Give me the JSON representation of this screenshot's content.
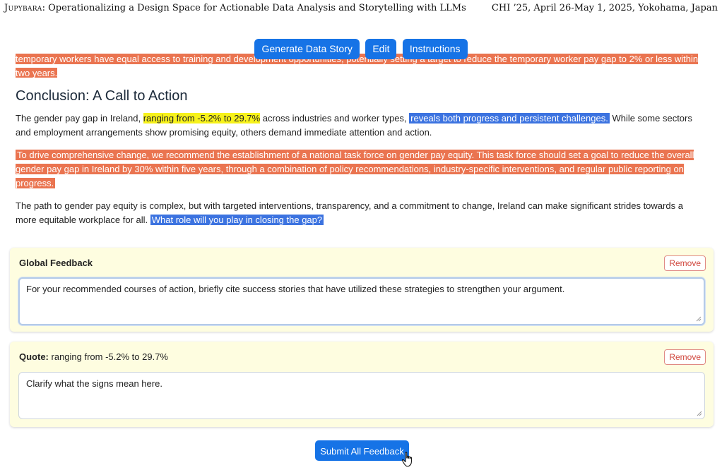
{
  "paper_header": {
    "brand": "Jupybara",
    "left_title": ": Operationalizing a Design Space for Actionable Data Analysis and Storytelling with LLMs",
    "right_text": "CHI ’25, April 26-May 1, 2025, Yokohama, Japan"
  },
  "toolbar": {
    "generate_label": "Generate Data Story",
    "edit_label": "Edit",
    "instructions_label": "Instructions"
  },
  "story": {
    "clipped_paragraph": "temporary workers have equal access to training and development opportunities, potentially setting a target to reduce the temporary worker pay gap to 2% or less within two years.",
    "heading": "Conclusion: A Call to Action",
    "p1_before": "The gender pay gap in Ireland, ",
    "p1_highlight_yellow": "ranging from -5.2% to 29.7%",
    "p1_middle": " across industries and worker types, ",
    "p1_highlight_blue": "reveals both progress and persistent challenges.",
    "p1_after": " While some sectors and employment arrangements show promising equity, others demand immediate attention and action.",
    "p2_highlight_orange": "To drive comprehensive change, we recommend the establishment of a national task force on gender pay equity. This task force should set a goal to reduce the overall gender pay gap in Ireland by 30% within five years, through a combination of policy recommendations, industry-specific interventions, and regular public reporting on progress.",
    "p3_text": "The path to gender pay equity is complex, but with targeted interventions, transparency, and a commitment to change, Ireland can make significant strides towards a more equitable workplace for all. ",
    "p3_highlight_blue": "What role will you play in closing the gap?"
  },
  "feedback": {
    "global": {
      "title": "Global Feedback",
      "remove_label": "Remove",
      "text": "For your recommended courses of action, briefly cite success stories that have utilized these strategies to strengthen your argument."
    },
    "quote": {
      "title_label": "Quote:",
      "quote_text": "ranging from -5.2% to 29.7%",
      "remove_label": "Remove",
      "text": "Clarify what the signs mean here."
    }
  },
  "submit_label": "Submit All Feedback",
  "colors": {
    "primary": "#1673e6",
    "highlight_orange": "#ea7450",
    "highlight_blue": "#3c73e0",
    "highlight_yellow": "#f7f21b",
    "card_bg": "#fefde0",
    "remove_red": "#d0463c"
  },
  "icons": {
    "cursor": "hand-pointer-icon"
  }
}
